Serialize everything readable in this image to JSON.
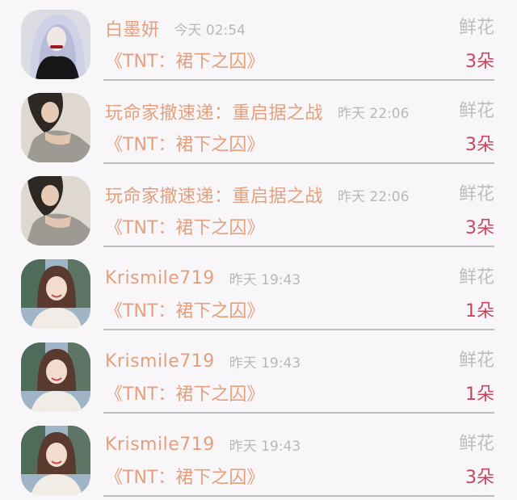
{
  "gifts": [
    {
      "name": "白墨妍",
      "time": "今天 02:54",
      "gift_label": "鲜花",
      "book": "《TNT：裙下之囚》",
      "amount": "3朵",
      "avatar": "gothic-woman"
    },
    {
      "name": "玩命家撤速递：重启据之战",
      "time": "昨天 22:06",
      "gift_label": "鲜花",
      "book": "《TNT：裙下之囚》",
      "amount": "3朵",
      "avatar": "woman-gray-top"
    },
    {
      "name": "玩命家撤速递：重启据之战",
      "time": "昨天 22:06",
      "gift_label": "鲜花",
      "book": "《TNT：裙下之囚》",
      "amount": "3朵",
      "avatar": "woman-gray-top"
    },
    {
      "name": "Krismile719",
      "time": "昨天 19:43",
      "gift_label": "鲜花",
      "book": "《TNT：裙下之囚》",
      "amount": "1朵",
      "avatar": "smiling-woman"
    },
    {
      "name": "Krismile719",
      "time": "昨天 19:43",
      "gift_label": "鲜花",
      "book": "《TNT：裙下之囚》",
      "amount": "1朵",
      "avatar": "smiling-woman"
    },
    {
      "name": "Krismile719",
      "time": "昨天 19:43",
      "gift_label": "鲜花",
      "book": "《TNT：裙下之囚》",
      "amount": "3朵",
      "avatar": "smiling-woman"
    }
  ],
  "colors": {
    "name": "#e4a07c",
    "book": "#e4a07c",
    "muted": "#bdbdc1",
    "amount": "#c7455f",
    "background": "#f8f6f8"
  }
}
